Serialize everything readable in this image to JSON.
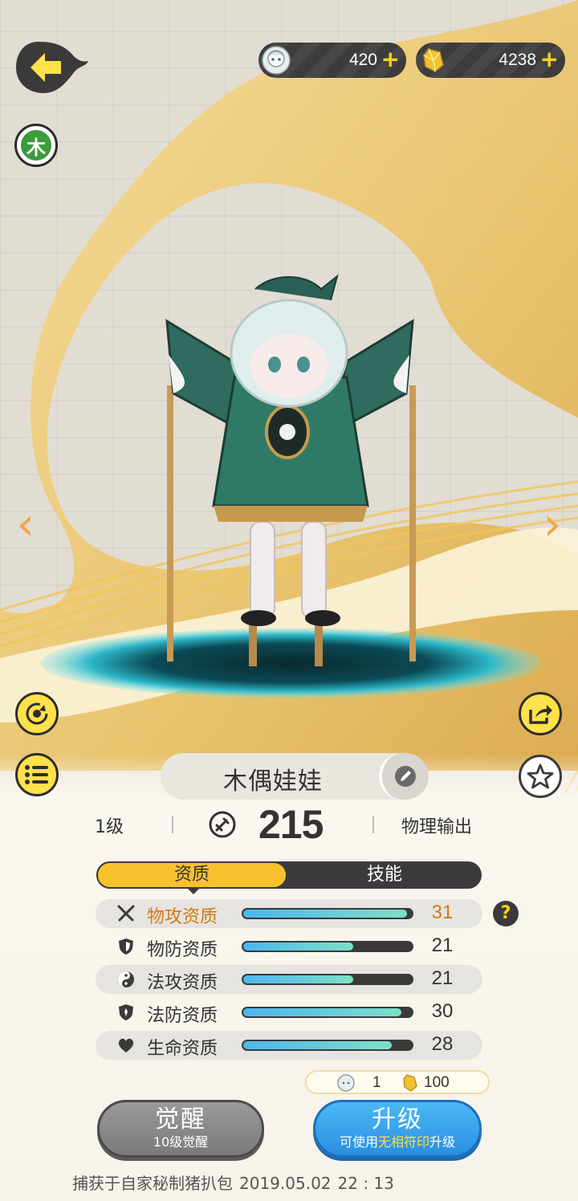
{
  "currencies": {
    "ghost": {
      "value": "420",
      "plus": "+"
    },
    "gold": {
      "value": "4238",
      "plus": "+"
    }
  },
  "element": {
    "label": "木",
    "color": "#3c9b3c"
  },
  "monster": {
    "name": "木偶娃娃",
    "level": "1级",
    "power": "215",
    "role": "物理输出"
  },
  "tabs": {
    "aptitude": "资质",
    "skills": "技能",
    "active": "aptitude"
  },
  "aptitudes": [
    {
      "label": "物攻资质",
      "icon": "crossed-swords-icon",
      "value": "31",
      "fill": 0.97
    },
    {
      "label": "物防资质",
      "icon": "shield-icon",
      "value": "21",
      "fill": 0.65
    },
    {
      "label": "法攻资质",
      "icon": "yin-yang-icon",
      "value": "21",
      "fill": 0.65
    },
    {
      "label": "法防资质",
      "icon": "magic-shield-icon",
      "value": "30",
      "fill": 0.94
    },
    {
      "label": "生命资质",
      "icon": "heart-icon",
      "value": "28",
      "fill": 0.88
    }
  ],
  "help_label": "?",
  "upgrade_cost": {
    "ghost_amount": "1",
    "gold_amount": "100"
  },
  "actions": {
    "awaken": {
      "title": "觉醒",
      "sub": "10级觉醒"
    },
    "upgrade": {
      "title": "升级",
      "sub_before": "可使用",
      "sub_highlight": "无相符印",
      "sub_after": "升级"
    }
  },
  "capture_info": {
    "text": "捕获于自家秘制猪扒包",
    "date": "2019.05.02",
    "time": "22 : 13"
  },
  "nav": {
    "prev": "‹",
    "next": "›"
  },
  "colors": {
    "accent_yellow": "#ffe14a",
    "gold_tab": "#f9c12e",
    "bar_fill": "#4bb6f0",
    "highlight_orange": "#d07a12"
  }
}
